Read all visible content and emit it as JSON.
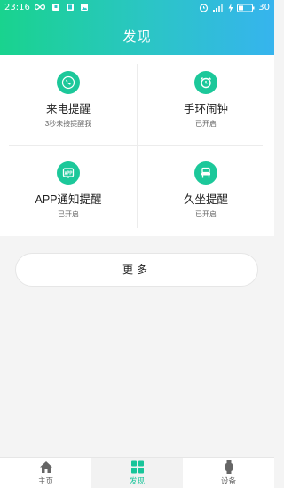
{
  "status_bar": {
    "time": "23:16",
    "battery": "30"
  },
  "header": {
    "title": "发现"
  },
  "features": [
    {
      "label": "来电提醒",
      "status": "3秒未接提醒我",
      "icon": "phone-icon"
    },
    {
      "label": "手环闹钟",
      "status": "已开启",
      "icon": "alarm-icon"
    },
    {
      "label": "APP通知提醒",
      "status": "已开启",
      "icon": "app-notify-icon"
    },
    {
      "label": "久坐提醒",
      "status": "已开启",
      "icon": "sedentary-icon"
    }
  ],
  "more_button": {
    "label": "更多"
  },
  "tabbar": {
    "items": [
      {
        "label": "主页",
        "icon": "home-icon"
      },
      {
        "label": "发现",
        "icon": "grid-icon",
        "active": true
      },
      {
        "label": "设备",
        "icon": "watch-icon"
      }
    ]
  },
  "colors": {
    "accent": "#1cc89a",
    "header_gradient_start": "#19d38e",
    "header_gradient_end": "#36b4ee"
  }
}
